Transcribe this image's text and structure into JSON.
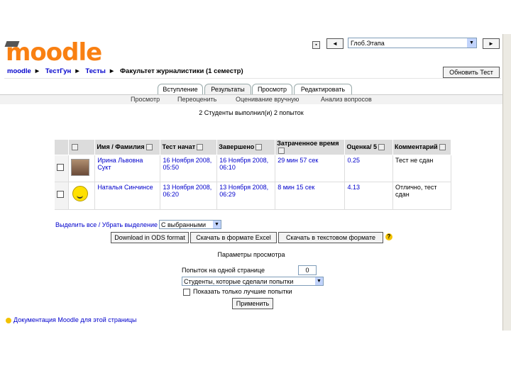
{
  "header": {
    "logo_text": "moodle",
    "jump_to_value": "Глоб.Этапа",
    "prev_symbol": "◄",
    "next_symbol": "►",
    "update_button": "Обновить Тест"
  },
  "breadcrumb": [
    "moodle",
    "ТестГун",
    "Тесты",
    "Факультет журналистики (1 семестр)"
  ],
  "breadcrumb_separator": "►",
  "tabs": [
    "Вступление",
    "Результаты",
    "Просмотр",
    "Редактировать"
  ],
  "subtabs": [
    "Просмотр",
    "Переоценить",
    "Оценивание вручную",
    "Анализ вопросов"
  ],
  "summary": "2 Студенты выполнил(и) 2 попыток",
  "table": {
    "headers": [
      "Имя / Фамилия",
      "Тест начат",
      "Завершено",
      "Затраченное время",
      "Оценка/ 5",
      "Комментарий"
    ],
    "rows": [
      {
        "name": "Ирина Львовна Сукт",
        "started": "16 Ноября 2008, 05:50",
        "completed": "16 Ноября 2008, 06:10",
        "time": "29 мин 57 сек",
        "grade": "0.25",
        "comment": "Тест не сдан"
      },
      {
        "name": "Наталья Синчинсе",
        "started": "13 Ноября 2008, 06:20",
        "completed": "13 Ноября 2008, 06:29",
        "time": "8 мин 15 сек",
        "grade": "4.13",
        "comment": "Отлично, тест сдан"
      }
    ]
  },
  "select_all_text": "Выделить все / Убрать выделение",
  "with_selected": "С выбранными",
  "download_buttons": [
    "Download in ODS format",
    "Скачать в формате Excel",
    "Скачать в текстовом формате"
  ],
  "preferences": {
    "title": "Параметры просмотра",
    "pagesize_label": "Попыток на одной странице",
    "pagesize_value": "0",
    "filter_value": "Студенты, которые сделали попытки",
    "best_label": "Показать только лучшие попытки",
    "apply_button": "Применить"
  },
  "footer_link": "Документация Moodle для этой страницы"
}
